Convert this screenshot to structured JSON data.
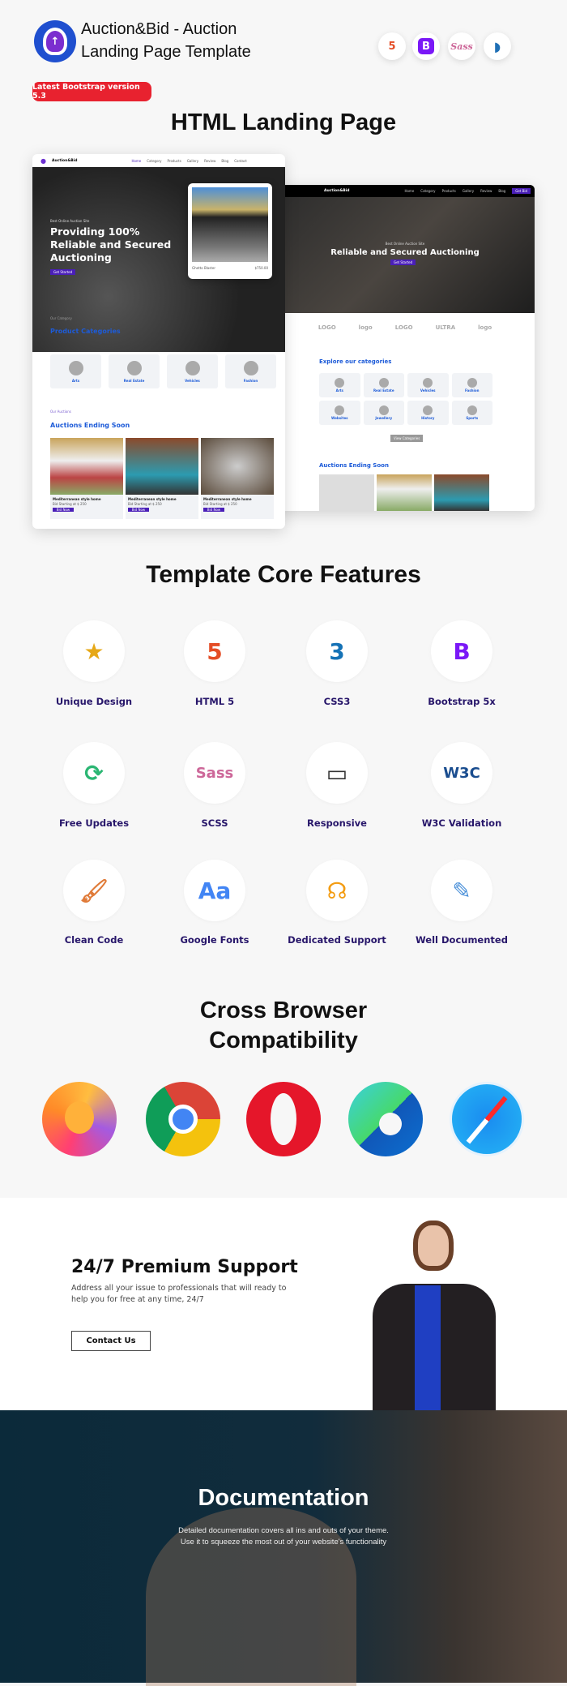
{
  "header": {
    "title_line1": "Auction&Bid -  Auction",
    "title_line2": "Landing Page Template",
    "badge": "Latest Bootstrap version 5.3",
    "tech_icons": [
      "html5-icon",
      "bootstrap-icon",
      "sass-icon",
      "jquery-icon"
    ]
  },
  "landing": {
    "heading": "HTML Landing Page"
  },
  "mock_left": {
    "brand": "Auction&Bid",
    "nav": [
      "Home",
      "Category",
      "Products",
      "Gallery",
      "Review",
      "Blog",
      "Contact"
    ],
    "eyebrow": "Best Online Auction Site",
    "headline": [
      "Providing 100%",
      "Reliable and Secured",
      "Auctioning"
    ],
    "cta": "Get Started",
    "product_caption": "Ghetto Blaster",
    "product_price": "$750.00",
    "cat_eyebrow": "Our Category",
    "cat_title": "Product Categories",
    "categories": [
      "Arts",
      "Real Estate",
      "Vehicles",
      "Fashion"
    ],
    "auc_eyebrow": "Our Auctions",
    "auc_title": "Auctions Ending Soon",
    "cards": [
      {
        "title": "Mediterranean style home",
        "bid": "Bid Starting at $ 250",
        "btn": "Bid Now"
      },
      {
        "title": "Mediterranean style home",
        "bid": "Bid Starting at $ 250",
        "btn": "Bid Now"
      },
      {
        "title": "Mediterranean style home",
        "bid": "Bid Starting at $ 250",
        "btn": "Bid Now"
      }
    ]
  },
  "mock_right": {
    "brand": "Auction&Bid",
    "nav": [
      "Home",
      "Category",
      "Products",
      "Gallery",
      "Review",
      "Blog"
    ],
    "nav_cta": "Get Bid",
    "eyebrow": "Best Online Auction Site",
    "headline": "Reliable and Secured Auctioning",
    "cta": "Get Started",
    "cat_title": "Explore our categories",
    "categories": [
      "Arts",
      "Real Estate",
      "Vehicles",
      "Fashion",
      "Websites",
      "Jewellery",
      "History",
      "Sports"
    ],
    "view_btn": "View Categories",
    "auc_title": "Auctions Ending Soon"
  },
  "features": {
    "heading": "Template Core Features",
    "items": [
      {
        "label": "Unique Design",
        "icon": "unique-design-icon"
      },
      {
        "label": "HTML 5",
        "icon": "html5-icon"
      },
      {
        "label": "CSS3",
        "icon": "css3-icon"
      },
      {
        "label": "Bootstrap 5x",
        "icon": "bootstrap-icon"
      },
      {
        "label": "Free Updates",
        "icon": "free-updates-icon"
      },
      {
        "label": "SCSS",
        "icon": "sass-icon"
      },
      {
        "label": "Responsive",
        "icon": "responsive-icon"
      },
      {
        "label": "W3C Validation",
        "icon": "w3c-icon"
      },
      {
        "label": "Clean Code",
        "icon": "clean-code-icon"
      },
      {
        "label": "Google Fonts",
        "icon": "google-fonts-icon"
      },
      {
        "label": "Dedicated Support",
        "icon": "support-icon"
      },
      {
        "label": "Well Documented",
        "icon": "documented-icon"
      }
    ]
  },
  "browsers": {
    "heading_line1": "Cross Browser",
    "heading_line2": "Compatibility",
    "items": [
      "firefox-icon",
      "chrome-icon",
      "opera-icon",
      "edge-icon",
      "safari-icon"
    ]
  },
  "support": {
    "heading": "24/7 Premium Support",
    "text_line1": "Address all your issue to professionals that will ready to",
    "text_line2": "help you for free at any time, 24/7",
    "button": "Contact Us"
  },
  "docs": {
    "heading": "Documentation",
    "text_line1": "Detailed documentation covers all ins and outs of your theme.",
    "text_line2": "Use it to squeeze the most out of your website's functionality"
  },
  "colors": {
    "badge": "#e8222f",
    "feature_label": "#27166a",
    "brand_purple": "#4a1fb8",
    "mock_blue": "#1d5bd8"
  }
}
